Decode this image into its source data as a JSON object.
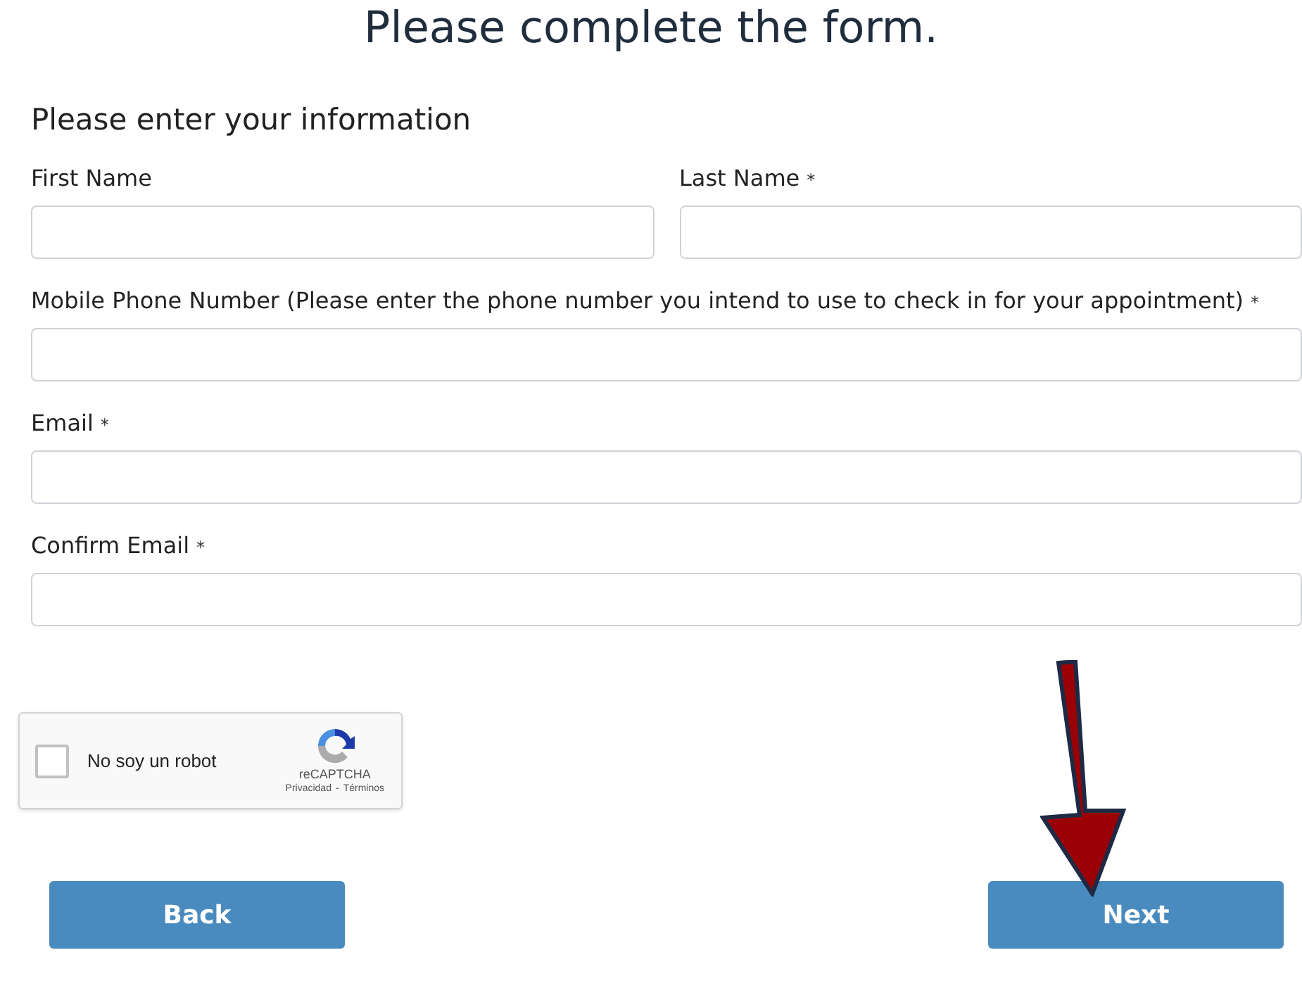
{
  "title": "Please complete the form.",
  "section_heading": "Please enter your information",
  "fields": [
    {
      "label": "First Name"
    },
    {
      "label": "Last Name",
      "required_mark": "*"
    },
    {
      "label": "Mobile Phone Number (Please enter the phone number you intend to use to check in for your appointment)",
      "required_mark": "*"
    },
    {
      "label": "Email",
      "required_mark": "*"
    },
    {
      "label": "Confirm Email",
      "required_mark": "*"
    }
  ],
  "captcha": {
    "label": "No soy un robot",
    "checked": false,
    "brand": "reCAPTCHA",
    "privacy": "Privacidad",
    "separator": "-",
    "terms": "Términos"
  },
  "buttons": [
    {
      "label": "Back"
    },
    {
      "label": "Next"
    }
  ]
}
